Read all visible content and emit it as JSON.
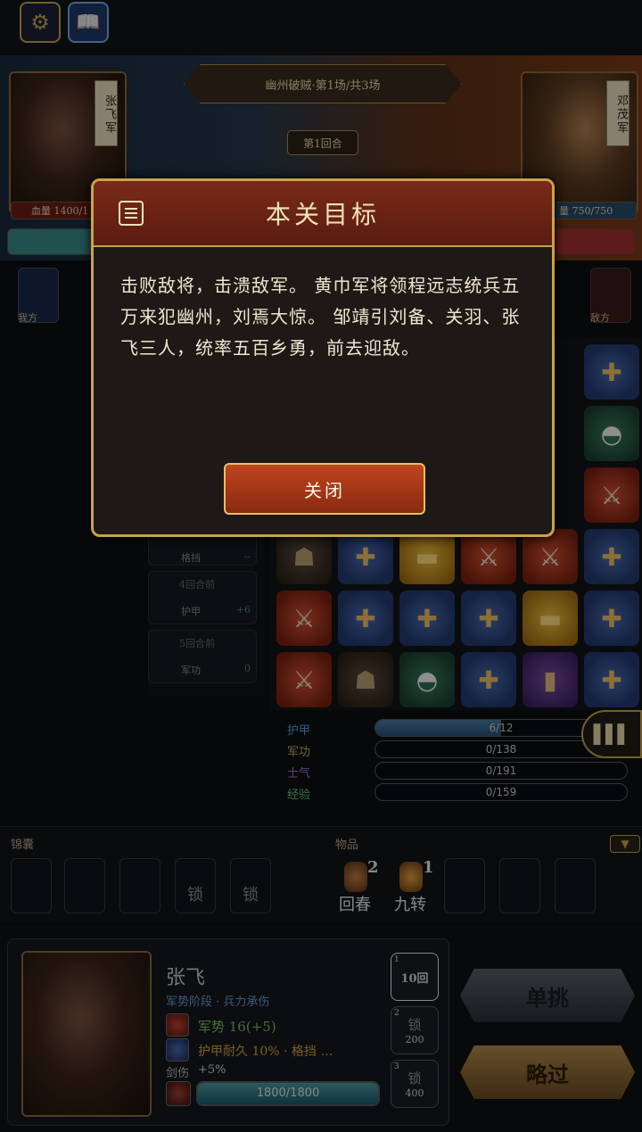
{
  "battle": {
    "stage_title": "幽州破贼·第1场/共3场",
    "round": "第1回合",
    "left_general": {
      "name": "张飞军",
      "hp_text": "血量 1400/1"
    },
    "right_general": {
      "name": "邓茂军",
      "hp_text": "量 750/750"
    },
    "left_side_label": "我方",
    "right_side_label": "敌方"
  },
  "skills": [
    {
      "name": "格挡",
      "value": "--"
    },
    {
      "cond": "4回合前",
      "name": "护甲",
      "value": "+6"
    },
    {
      "cond": "5回合前",
      "name": "军功",
      "value": "0"
    }
  ],
  "board": [
    [
      "",
      "",
      "",
      "",
      "",
      "shield"
    ],
    [
      "",
      "",
      "",
      "",
      "",
      "rice"
    ],
    [
      "",
      "",
      "",
      "",
      "",
      "sword"
    ],
    [
      "sol",
      "shield",
      "gold",
      "sword",
      "sword",
      "shield"
    ],
    [
      "sword",
      "shield",
      "shield",
      "shield",
      "gold",
      "shield"
    ],
    [
      "sword",
      "sol",
      "rice",
      "shield",
      "scroll",
      "shield"
    ]
  ],
  "stats": [
    {
      "label": "护甲",
      "text": "6/12",
      "fraction": 0.5,
      "color": "#5aa0e8"
    },
    {
      "label": "军功",
      "text": "0/138",
      "fraction": 0,
      "color": "#c8a860"
    },
    {
      "label": "士气",
      "text": "0/191",
      "fraction": 0,
      "color": "#a070d0"
    },
    {
      "label": "经验",
      "text": "0/159",
      "fraction": 0,
      "color": "#70c070"
    }
  ],
  "inventory": {
    "bag_label": "锦囊",
    "items_label": "物品",
    "lock_label": "锁",
    "items": [
      {
        "name": "回春",
        "count": "2"
      },
      {
        "name": "九转",
        "count": "1"
      }
    ]
  },
  "hero": {
    "name": "张飞",
    "phase": "军势阶段 · 兵力承伤",
    "momentum": "军势 16(+5)",
    "armor_line": "护甲耐久 10% · 格挡 …",
    "wound_label": "剑伤",
    "wound_value": "+5%",
    "hp_text": "1800/1800",
    "hp_fraction": 1.0
  },
  "cooldowns": [
    {
      "idx": "1",
      "top": "10回",
      "bottom": ""
    },
    {
      "idx": "2",
      "top": "锁",
      "bottom": "200"
    },
    {
      "idx": "3",
      "top": "锁",
      "bottom": "400"
    }
  ],
  "actions": {
    "duel": "单挑",
    "skip": "略过"
  },
  "modal": {
    "title": "本关目标",
    "body": "击败敌将，击溃敌军。 黄巾军将领程远志统兵五万来犯幽州，刘焉大惊。 邹靖引刘备、关羽、张飞三人，统率五百乡勇，前去迎敌。",
    "close_label": "关闭"
  }
}
